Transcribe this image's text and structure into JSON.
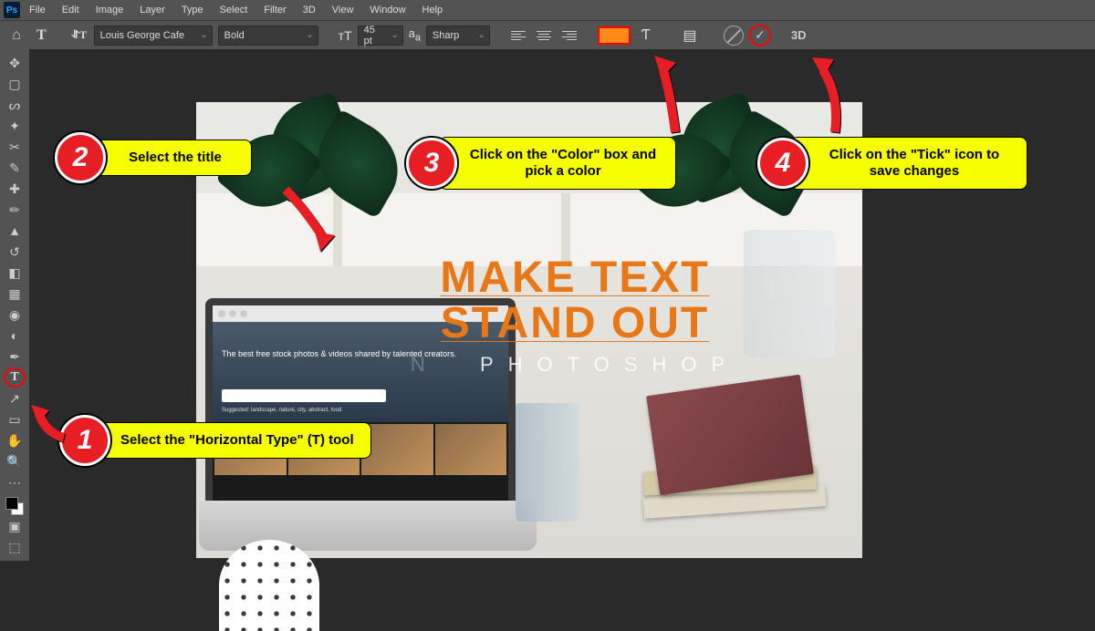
{
  "menubar": {
    "items": [
      "File",
      "Edit",
      "Image",
      "Layer",
      "Type",
      "Select",
      "Filter",
      "3D",
      "View",
      "Window",
      "Help"
    ]
  },
  "options": {
    "font": "Louis George Cafe",
    "weight": "Bold",
    "size": "45 pt",
    "antialias": "Sharp",
    "color": "#ff8c1a",
    "threed": "3D"
  },
  "canvas": {
    "title_line1": "MAKE TEXT",
    "title_line2": "STAND OUT",
    "subtitle_prefix": "N",
    "subtitle": "PHOTOSHOP",
    "site_tagline": "The best free stock photos & videos shared by talented creators.",
    "site_tags": "Suggested: landscape, nature, city, abstract, food"
  },
  "callouts": {
    "c1": {
      "num": "1",
      "text": "Select the \"Horizontal Type\" (T) tool"
    },
    "c2": {
      "num": "2",
      "text": "Select the title"
    },
    "c3": {
      "num": "3",
      "text": "Click on the \"Color\" box and pick a color"
    },
    "c4": {
      "num": "4",
      "text": "Click on the \"Tick\" icon to save changes"
    }
  }
}
